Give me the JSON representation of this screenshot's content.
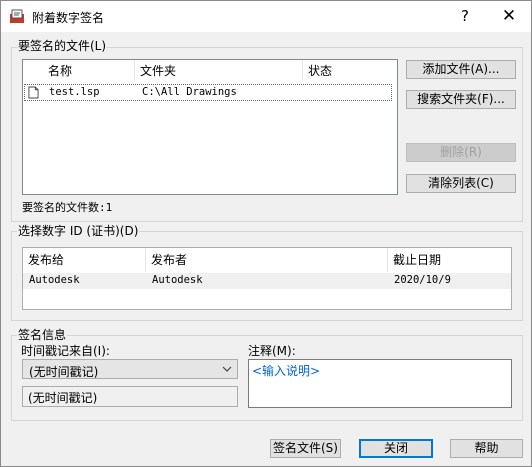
{
  "window": {
    "title": "附着数字签名",
    "help_glyph": "?",
    "close_glyph": "✕"
  },
  "files_group": {
    "label": "要签名的文件(L)",
    "columns": [
      "名称",
      "文件夹",
      "状态"
    ],
    "rows": [
      {
        "name": "test.lsp",
        "folder": "C:\\All Drawings",
        "status": ""
      }
    ],
    "count_label": "要签名的文件数:1"
  },
  "file_buttons": {
    "add": "添加文件(A)...",
    "search": "搜索文件夹(F)...",
    "delete": "删除(R)",
    "clear": "清除列表(C)"
  },
  "cert_group": {
    "label": "选择数字 ID (证书)(D)",
    "columns": [
      "发布给",
      "发布者",
      "截止日期"
    ],
    "rows": [
      {
        "issued_to": "Autodesk",
        "issued_by": "Autodesk",
        "expires": "2020/10/9"
      }
    ]
  },
  "sig_group": {
    "label": "签名信息",
    "timestamp_label": "时间戳记来自(I):",
    "timestamp_value": "(无时间戳记)",
    "timestamp_display": "(无时间戳记)",
    "comment_label": "注释(M):",
    "comment_placeholder": "<输入说明>"
  },
  "footer": {
    "sign": "签名文件(S)",
    "close": "关闭",
    "help": "帮助"
  },
  "colors": {
    "accent": "#0078d7",
    "placeholder": "#0066cc",
    "selection": "#cce8ff"
  }
}
